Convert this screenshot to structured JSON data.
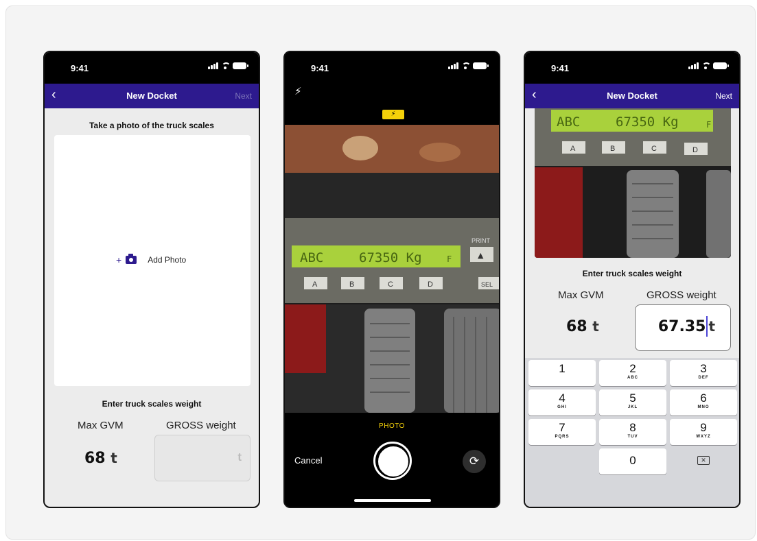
{
  "status": {
    "time": "9:41"
  },
  "screen1": {
    "nav": {
      "back": "‹",
      "title": "New Docket",
      "next": "Next"
    },
    "photo_section_title": "Take a photo of the truck scales",
    "add_photo_plus": "+",
    "add_photo_label": "Add Photo",
    "weight_section_title": "Enter truck scales weight",
    "max_gvm_label": "Max GVM",
    "gross_label": "GROSS weight",
    "max_gvm_value": "68",
    "unit": "t"
  },
  "screen2": {
    "flash_icon": "⚡",
    "flash_badge": "⚡",
    "mode_label": "PHOTO",
    "cancel": "Cancel",
    "flip_icon": "⟳",
    "scale_display": {
      "left": "ABC",
      "reading": "67350 Kg",
      "suffix": "F",
      "print_label": "PRINT",
      "print_key": "▲",
      "keys": [
        "A",
        "B",
        "C",
        "D"
      ],
      "sel": "SEL"
    }
  },
  "screen3": {
    "nav": {
      "back": "‹",
      "title": "New Docket",
      "next": "Next"
    },
    "scale_display": {
      "left": "ABC",
      "reading": "67350 Kg",
      "suffix": "F",
      "keys": [
        "A",
        "B",
        "C",
        "D"
      ]
    },
    "weight_section_title": "Enter truck scales weight",
    "max_gvm_label": "Max GVM",
    "gross_label": "GROSS weight",
    "max_gvm_value": "68",
    "gross_value": "67.35",
    "unit": "t",
    "keypad": [
      {
        "num": "1",
        "letters": ""
      },
      {
        "num": "2",
        "letters": "ABC"
      },
      {
        "num": "3",
        "letters": "DEF"
      },
      {
        "num": "4",
        "letters": "GHI"
      },
      {
        "num": "5",
        "letters": "JKL"
      },
      {
        "num": "6",
        "letters": "MNO"
      },
      {
        "num": "7",
        "letters": "PQRS"
      },
      {
        "num": "8",
        "letters": "TUV"
      },
      {
        "num": "9",
        "letters": "WXYZ"
      },
      {
        "num": "0",
        "letters": ""
      }
    ],
    "delete_icon": "✕"
  },
  "colors": {
    "brand": "#2d1a8e",
    "flash": "#f5d10a",
    "lcd": "#a9d13c"
  }
}
